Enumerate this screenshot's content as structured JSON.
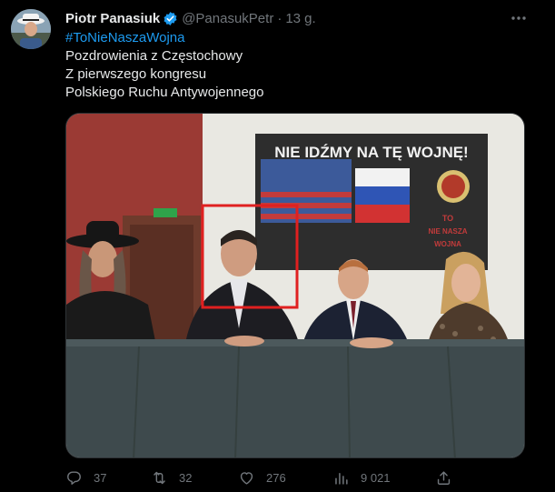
{
  "tweet": {
    "author_name": "Piotr Panasiuk",
    "handle": "@PanasukPetr",
    "separator": "·",
    "time": "13 g.",
    "hashtag": "#ToNieNaszaWojna",
    "lines": [
      "Pozdrowienia z Częstochowy",
      "Z pierwszego kongresu",
      "Polskiego Ruchu Antywojennego"
    ]
  },
  "photo": {
    "banner_text": "NIE IDŹMY NA TĘ WOJNĘ!",
    "banner_lower_text": [
      "TO",
      "NIE NASZA",
      "WOJNA"
    ],
    "highlight_color": "#e02020"
  },
  "actions": {
    "replies": "37",
    "retweets": "32",
    "likes": "276",
    "views": "9 021"
  },
  "icons": {
    "verified": "verified-badge-icon",
    "more": "more-dots-icon",
    "reply": "reply-icon",
    "retweet": "retweet-icon",
    "like": "heart-icon",
    "views": "views-chart-icon",
    "share": "share-icon"
  },
  "colors": {
    "background": "#000000",
    "text": "#e7e9ea",
    "muted": "#71767b",
    "link": "#1d9bf0",
    "verified": "#1d9bf0"
  }
}
